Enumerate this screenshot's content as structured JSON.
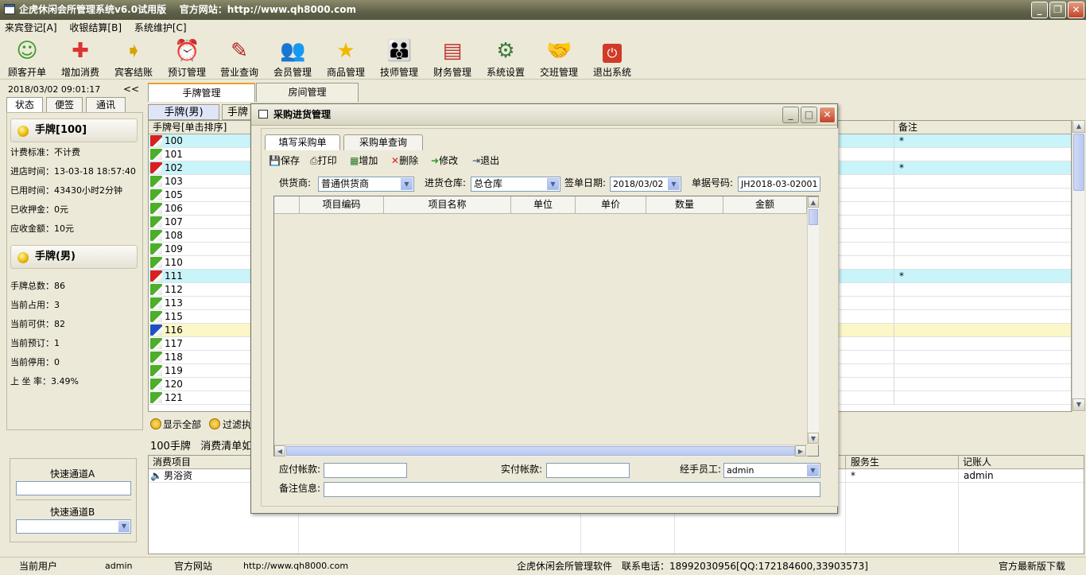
{
  "window": {
    "title": "企虎休闲会所管理系统v6.0试用版    官方网站：http://www.qh8000.com"
  },
  "menu": [
    "来宾登记[A]",
    "收银结算[B]",
    "系统维护[C]"
  ],
  "toolbar": [
    {
      "label": "顾客开单",
      "icon": "customer-icon"
    },
    {
      "label": "增加消费",
      "icon": "add-consumption-icon"
    },
    {
      "label": "宾客结账",
      "icon": "checkout-icon"
    },
    {
      "label": "预订管理",
      "icon": "alarm-clock-icon"
    },
    {
      "label": "营业查询",
      "icon": "business-query-icon"
    },
    {
      "label": "会员管理",
      "icon": "members-icon"
    },
    {
      "label": "商品管理",
      "icon": "star-icon"
    },
    {
      "label": "技师管理",
      "icon": "technician-icon"
    },
    {
      "label": "财务管理",
      "icon": "finance-icon"
    },
    {
      "label": "系统设置",
      "icon": "settings-icon"
    },
    {
      "label": "交班管理",
      "icon": "handshake-icon"
    },
    {
      "label": "退出系统",
      "icon": "power-icon"
    }
  ],
  "left": {
    "datetime": "2018/03/02  09:01:17",
    "collapse": "<<",
    "tabs": [
      "状态",
      "便签",
      "通讯"
    ],
    "section1": {
      "title": "手牌[100]",
      "lines": [
        "计费标准：不计费",
        "进店时间：13-03-18 18:57:40",
        "已用时间：43430小时2分钟",
        "已收押金：0元",
        "应收金额：10元"
      ]
    },
    "section2": {
      "title": "手牌(男)",
      "lines": [
        "手牌总数：86",
        "当前占用：3",
        "当前可供：82",
        "当前预订：1",
        "当前停用：0",
        "上 坐 率：3.49%"
      ]
    },
    "quickA": "快速通道A",
    "quickB": "快速通道B"
  },
  "main": {
    "tabs": [
      "手牌管理",
      "房间管理"
    ],
    "subtabs": [
      "手牌(男)",
      "手牌"
    ],
    "grid": {
      "col1": "手牌号[单击排序]",
      "col_note": "备注",
      "rows": [
        {
          "no": "100",
          "status": "occupied",
          "note": "*"
        },
        {
          "no": "101",
          "status": "free",
          "note": ""
        },
        {
          "no": "102",
          "status": "occupied",
          "note": "*"
        },
        {
          "no": "103",
          "status": "free",
          "note": ""
        },
        {
          "no": "105",
          "status": "free",
          "note": ""
        },
        {
          "no": "106",
          "status": "free",
          "note": ""
        },
        {
          "no": "107",
          "status": "free",
          "note": ""
        },
        {
          "no": "108",
          "status": "free",
          "note": ""
        },
        {
          "no": "109",
          "status": "free",
          "note": ""
        },
        {
          "no": "110",
          "status": "free",
          "note": ""
        },
        {
          "no": "111",
          "status": "occupied",
          "note": "*"
        },
        {
          "no": "112",
          "status": "free",
          "note": ""
        },
        {
          "no": "113",
          "status": "free",
          "note": ""
        },
        {
          "no": "115",
          "status": "free",
          "note": ""
        },
        {
          "no": "116",
          "status": "reserved",
          "note": ""
        },
        {
          "no": "117",
          "status": "free",
          "note": ""
        },
        {
          "no": "118",
          "status": "free",
          "note": ""
        },
        {
          "no": "119",
          "status": "free",
          "note": ""
        },
        {
          "no": "120",
          "status": "free",
          "note": ""
        },
        {
          "no": "121",
          "status": "free",
          "note": ""
        }
      ]
    },
    "show_all": "显示全部",
    "filter": "过滤执",
    "consumption_title": "100手牌   消费清单如",
    "lower": {
      "col_item": "消费项目",
      "col_waiter": "服务生",
      "col_recorder": "记账人",
      "item": "男浴资",
      "waiter": "*",
      "recorder": "admin"
    }
  },
  "colors": {
    "occupied": "#c8f4fa",
    "reserved": "#fbf7c8",
    "free": "#ffffff"
  },
  "dialog": {
    "title": "采购进货管理",
    "tabs": [
      "填写采购单",
      "采购单查询"
    ],
    "tools": [
      "保存",
      "打印",
      "增加",
      "删除",
      "修改",
      "退出"
    ],
    "supplier_label": "供货商:",
    "supplier": "普通供货商",
    "warehouse_label": "进货仓库:",
    "warehouse": "总仓库",
    "date_label": "签单日期:",
    "date": "2018/03/02",
    "doc_label": "单据号码:",
    "doc_no": "JH2018-03-02001",
    "columns": [
      "项目编码",
      "项目名称",
      "单位",
      "单价",
      "数量",
      "金额"
    ],
    "payable_label": "应付帐款:",
    "paid_label": "实付帐款:",
    "staff_label": "经手员工:",
    "staff": "admin",
    "note_label": "备注信息:"
  },
  "status": {
    "user_label": "当前用户",
    "user": "admin",
    "site_label": "官方网站",
    "site": "http://www.qh8000.com",
    "company": "企虎休闲会所管理软件",
    "phone": "联系电话：18992030956[QQ:172184600,33903573]",
    "download": "官方最新版下载"
  }
}
